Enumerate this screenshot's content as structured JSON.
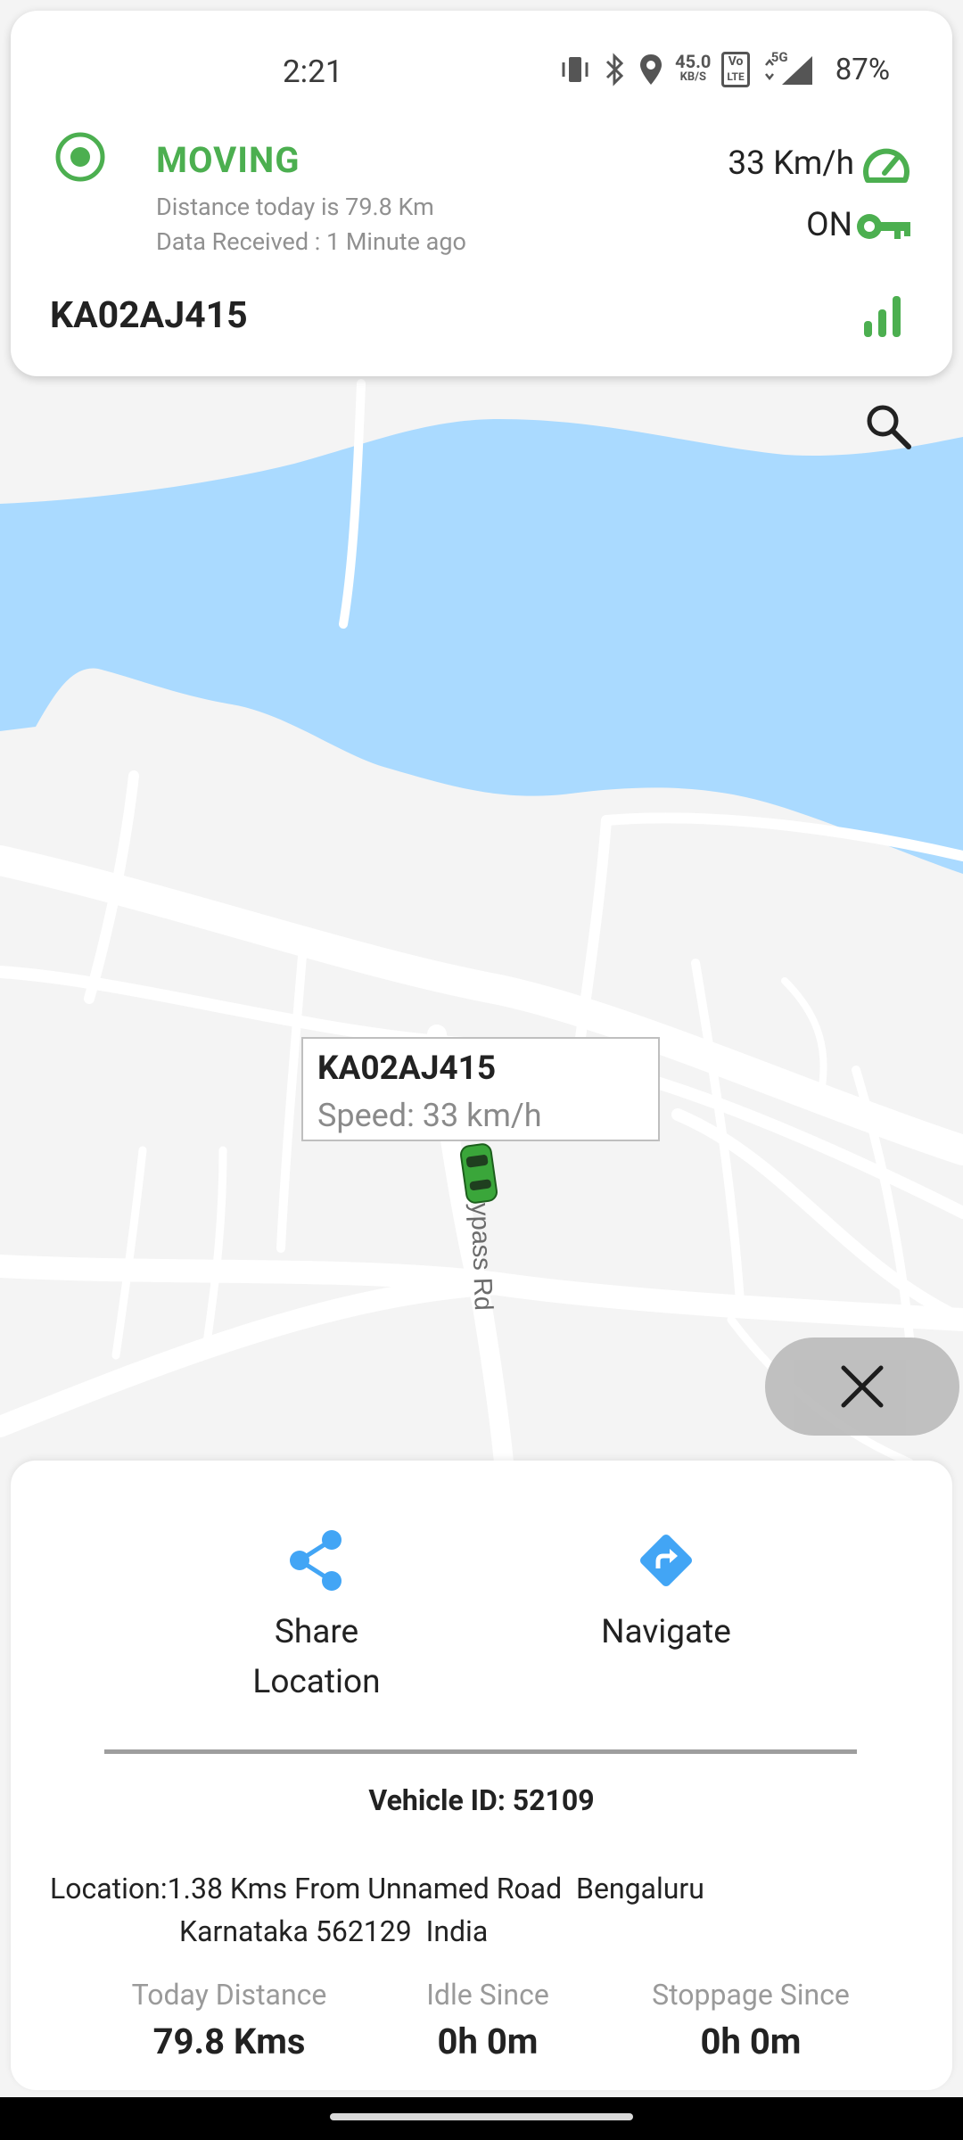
{
  "status_bar": {
    "time": "2:21",
    "net_speed_value": "45.0",
    "net_speed_unit": "KB/S",
    "volte_line1": "Vo",
    "volte_line2": "LTE",
    "net_type": "5G",
    "battery": "87%"
  },
  "vehicle_status": {
    "state": "MOVING",
    "distance_today": "Distance today is 79.8 Km",
    "data_received": "Data Received : 1 Minute ago",
    "speed": "33 Km/h",
    "ignition": "ON",
    "plate": "KA02AJ415"
  },
  "map": {
    "road_label": "Bypass Rd",
    "popup": {
      "title": "KA02AJ415",
      "speed": "Speed: 33 km/h"
    }
  },
  "bottom_sheet": {
    "share_label_line1": "Share",
    "share_label_line2": "Location",
    "navigate_label": "Navigate",
    "vehicle_id": "Vehicle ID: 52109",
    "location_line1": "Location:1.38 Kms From Unnamed Road  Bengaluru",
    "location_line2": "Karnataka 562129  India",
    "stats": [
      {
        "label": "Today Distance",
        "value": "79.8 Kms"
      },
      {
        "label": "Idle Since",
        "value": "0h 0m"
      },
      {
        "label": "Stoppage Since",
        "value": "0h 0m"
      }
    ]
  },
  "colors": {
    "moving_green": "#4caf50",
    "water_blue": "#aadaff",
    "action_blue": "#42a5f5",
    "map_background": "#f4f4f4"
  },
  "icons": [
    "moving-status-icon",
    "speedometer-icon",
    "ignition-key-icon",
    "signal-strength-icon",
    "search-icon",
    "car-marker-icon",
    "close-icon",
    "share-icon",
    "navigate-icon"
  ]
}
